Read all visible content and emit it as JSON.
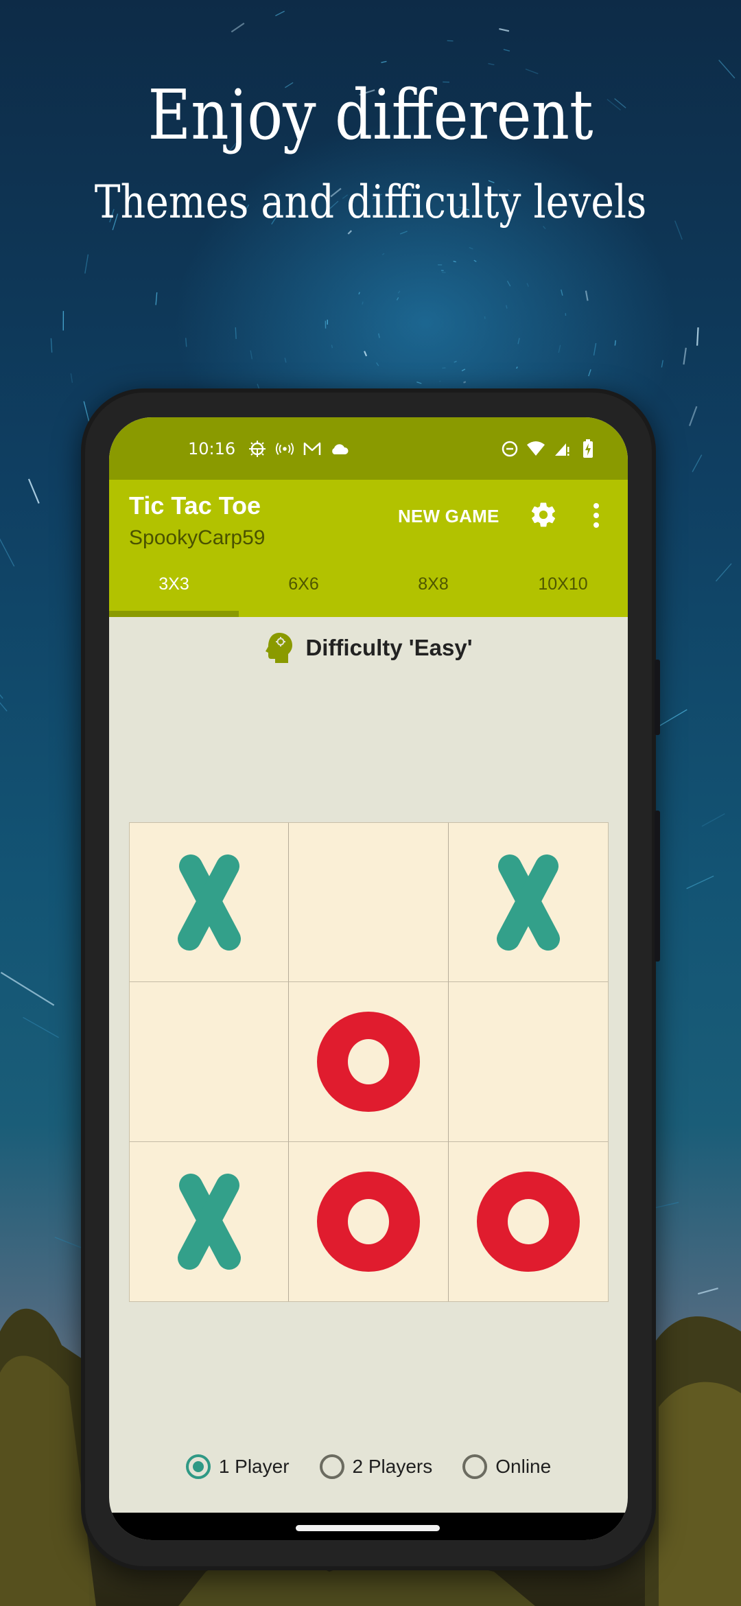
{
  "promo": {
    "headline": "Enjoy different",
    "subheadline": "Themes and difficulty levels"
  },
  "status_bar": {
    "time": "10:16",
    "left_icons": [
      "debug-bug-icon",
      "hotspot-broadcast-icon",
      "gmail-icon",
      "cloud-icon"
    ],
    "right_icons": [
      "do-not-disturb-icon",
      "wifi-icon",
      "cellular-signal-icon",
      "battery-charging-icon"
    ]
  },
  "app_bar": {
    "title": "Tic Tac Toe",
    "subtitle": "SpookyCarp59",
    "new_game_label": "NEW GAME",
    "settings_icon": "gear-icon",
    "overflow_icon": "more-vertical-icon"
  },
  "tabs": [
    {
      "label": "3X3",
      "active": true
    },
    {
      "label": "6X6",
      "active": false
    },
    {
      "label": "8X8",
      "active": false
    },
    {
      "label": "10X10",
      "active": false
    }
  ],
  "difficulty": {
    "icon": "brain-head-icon",
    "label": "Difficulty 'Easy'"
  },
  "board": {
    "size": 3,
    "cells": [
      "X",
      "",
      "X",
      "",
      "O",
      "",
      "X",
      "O",
      "O"
    ]
  },
  "modes": [
    {
      "label": "1 Player",
      "checked": true
    },
    {
      "label": "2 Players",
      "checked": false
    },
    {
      "label": "Online",
      "checked": false
    }
  ],
  "colors": {
    "status_bar": "#8a9a00",
    "app_bar": "#b2c200",
    "x_mark": "#33a08a",
    "o_mark": "#e01c2e",
    "board_bg": "#faefd6",
    "screen_bg": "#e4e4d6",
    "radio_checked": "#2f9985"
  }
}
